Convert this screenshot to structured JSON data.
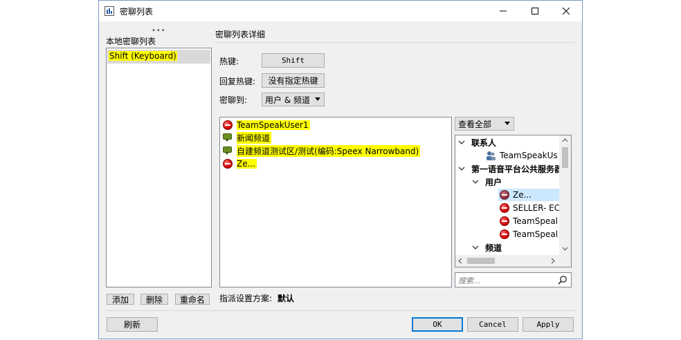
{
  "window": {
    "title": "密聊列表"
  },
  "left": {
    "label": "本地密聊列表",
    "dots": "•••",
    "items": [
      "Shift (Keyboard)"
    ],
    "add": "添加",
    "delete": "删除",
    "rename": "重命名"
  },
  "details": {
    "label": "密聊列表详细",
    "hotkey_label": "热键:",
    "hotkey_value": "Shift",
    "reply_label": "回复热键:",
    "reply_value": "没有指定热键",
    "target_label": "密聊到:",
    "target_value": "用户 & 频道",
    "targets": [
      {
        "icon": "red-ball",
        "text": "TeamSpeakUser1"
      },
      {
        "icon": "chat",
        "text": "新闻频道"
      },
      {
        "icon": "chat",
        "text": "自建频道测试区/测试(编码:Speex Narrowband)"
      },
      {
        "icon": "red-ball",
        "text": "Ze..."
      }
    ],
    "scheme_label": "指派设置方案:",
    "scheme_value": "默认"
  },
  "tree": {
    "filter": "查看全部",
    "contacts": "联系人",
    "contact_user": "TeamSpeakUs",
    "server": "第一语音平台公共服务器",
    "users": "用户",
    "user_items": [
      "Ze...",
      "SELLER- EC",
      "TeamSpeal",
      "TeamSpeal"
    ],
    "channels": "频道",
    "search_placeholder": "搜索..."
  },
  "footer": {
    "refresh": "刷新",
    "ok": "OK",
    "cancel": "Cancel",
    "apply": "Apply"
  }
}
